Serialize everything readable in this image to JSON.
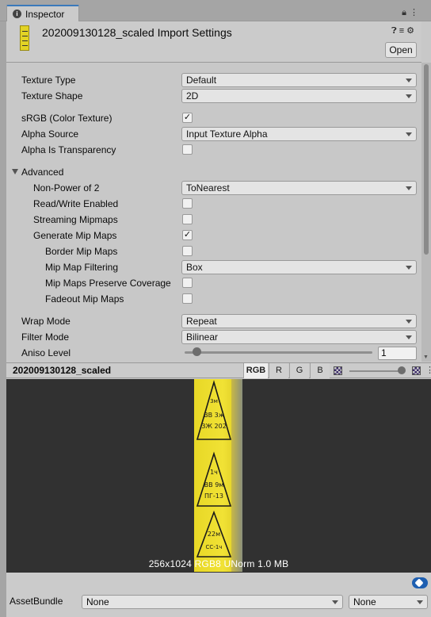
{
  "tab": {
    "label": "Inspector"
  },
  "header": {
    "title": "202009130128_scaled Import Settings",
    "icons": [
      "help-icon",
      "presets-icon",
      "settings-icon"
    ],
    "open_label": "Open"
  },
  "properties": {
    "texture_type": {
      "label": "Texture Type",
      "value": "Default"
    },
    "texture_shape": {
      "label": "Texture Shape",
      "value": "2D"
    },
    "srgb": {
      "label": "sRGB (Color Texture)",
      "checked": true
    },
    "alpha_source": {
      "label": "Alpha Source",
      "value": "Input Texture Alpha"
    },
    "alpha_is_transparency": {
      "label": "Alpha Is Transparency",
      "checked": false
    },
    "advanced": {
      "label": "Advanced"
    },
    "non_power_of_2": {
      "label": "Non-Power of 2",
      "value": "ToNearest"
    },
    "read_write": {
      "label": "Read/Write Enabled",
      "checked": false
    },
    "streaming_mipmaps": {
      "label": "Streaming Mipmaps",
      "checked": false
    },
    "generate_mip_maps": {
      "label": "Generate Mip Maps",
      "checked": true
    },
    "border_mip_maps": {
      "label": "Border Mip Maps",
      "checked": false
    },
    "mip_map_filtering": {
      "label": "Mip Map Filtering",
      "value": "Box"
    },
    "mip_maps_preserve_coverage": {
      "label": "Mip Maps Preserve Coverage",
      "checked": false
    },
    "fadeout_mip_maps": {
      "label": "Fadeout Mip Maps",
      "checked": false
    },
    "wrap_mode": {
      "label": "Wrap Mode",
      "value": "Repeat"
    },
    "filter_mode": {
      "label": "Filter Mode",
      "value": "Bilinear"
    },
    "aniso_level": {
      "label": "Aniso Level",
      "value": "1"
    }
  },
  "preview": {
    "title": "202009130128_scaled",
    "channels": [
      "RGB",
      "R",
      "G",
      "B"
    ],
    "active_channel": "RGB",
    "info": "256x1024  RGB8 UNorm   1.0 MB",
    "texture_glyphs": [
      "3м",
      "ВВ 3ж",
      "ЗЖ 202",
      "1ч",
      "ВВ 9м",
      "ПГ-13",
      "22м",
      "СС-1ч"
    ]
  },
  "asset_bundle": {
    "label": "AssetBundle",
    "name_value": "None",
    "variant_value": "None"
  },
  "colors": {
    "accent": "#3a79bb",
    "panel": "#cbcbcb",
    "preview_bg": "#313131",
    "texture_yellow": "#e8d826"
  }
}
